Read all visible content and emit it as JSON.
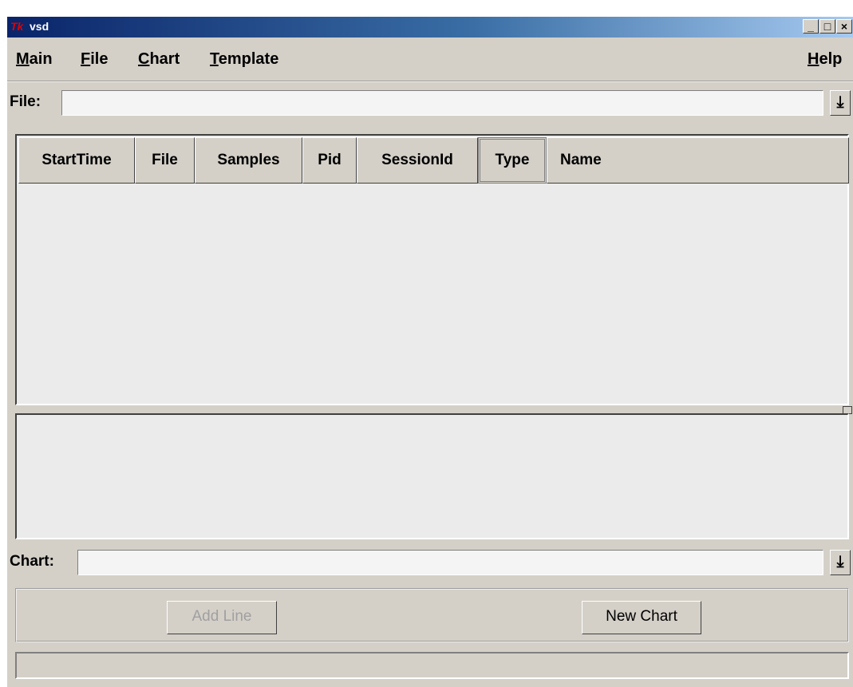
{
  "window": {
    "title": "vsd",
    "app_icon": "Tk"
  },
  "window_controls": {
    "minimize": "_",
    "maximize": "□",
    "close": "×"
  },
  "menu": {
    "main": {
      "accel": "M",
      "rest": "ain"
    },
    "file": {
      "accel": "F",
      "rest": "ile"
    },
    "chart": {
      "accel": "C",
      "rest": "hart"
    },
    "template": {
      "accel": "T",
      "rest": "emplate"
    },
    "help": {
      "accel": "H",
      "rest": "elp"
    }
  },
  "file_field": {
    "label": "File:",
    "value": "",
    "dropdown_icon": "⤓"
  },
  "table": {
    "columns": [
      "StartTime",
      "File",
      "Samples",
      "Pid",
      "SessionId",
      "Type",
      "Name"
    ],
    "rows": []
  },
  "chart_field": {
    "label": "Chart:",
    "value": "",
    "dropdown_icon": "⤓"
  },
  "buttons": {
    "add_line": "Add Line",
    "new_chart": "New Chart"
  },
  "status": {
    "text": ""
  }
}
